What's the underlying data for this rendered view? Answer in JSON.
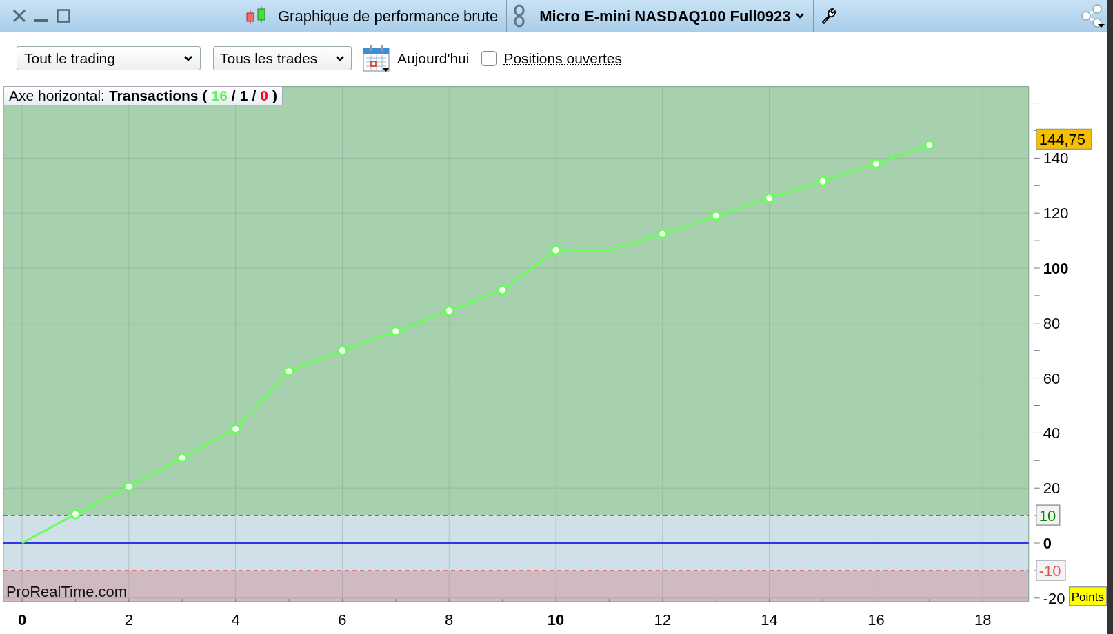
{
  "window": {
    "title": "Graphique de performance brute",
    "instrument": "Micro E-mini NASDAQ100 Full0923"
  },
  "toolbar": {
    "scope_select": "Tout le trading",
    "trades_select": "Tous les trades",
    "date_label": "Aujourd'hui",
    "open_positions": {
      "label": "Positions ouvertes",
      "checked": false
    }
  },
  "chart": {
    "legend": {
      "label": "Axe horizontal:",
      "axis_name": "Transactions",
      "tokens": [
        {
          "text": "(",
          "color": "#000000"
        },
        {
          "text": "16",
          "color": "#66ee66"
        },
        {
          "text": "/",
          "color": "#000000"
        },
        {
          "text": "1",
          "color": "#000000"
        },
        {
          "text": "/",
          "color": "#000000"
        },
        {
          "text": "0",
          "color": "#ff0022"
        },
        {
          "text": ")",
          "color": "#000000"
        }
      ]
    },
    "brand_label": "ProRealTime.com",
    "last_value": "144,75",
    "unit_label": "Points",
    "chart_data": {
      "type": "line",
      "x": [
        0,
        1,
        2,
        3,
        4,
        5,
        6,
        7,
        8,
        9,
        10,
        11,
        12,
        13,
        14,
        15,
        16,
        17
      ],
      "series": [
        {
          "color": "#66ff55",
          "marker": "o",
          "values": [
            0,
            10.5,
            20.5,
            31,
            41.5,
            62.5,
            70,
            77,
            84.5,
            92,
            106.5,
            106.5,
            112.5,
            119,
            125.5,
            131.5,
            138,
            144.75
          ]
        }
      ],
      "xlim": [
        -0.35,
        18.86
      ],
      "ylim": [
        -21.3,
        166
      ],
      "xticks": [
        0,
        2,
        4,
        6,
        8,
        10,
        12,
        14,
        16,
        18
      ],
      "yticks": [
        -20,
        0,
        20,
        40,
        60,
        80,
        100,
        120,
        140
      ],
      "grid": true,
      "bands": [
        {
          "axis": "y",
          "from": 10,
          "to": 166,
          "color": "#a7d1ae"
        },
        {
          "axis": "y",
          "from": -10,
          "to": 10,
          "color": "#d0e0e8"
        },
        {
          "axis": "y",
          "from": -21.3,
          "to": -10,
          "color": "#d0bac2"
        }
      ],
      "ref_lines": [
        {
          "axis": "y",
          "value": 10,
          "label": "10",
          "color": "#008800"
        },
        {
          "axis": "y",
          "value": 0,
          "color": "#0000ee"
        },
        {
          "axis": "y",
          "value": -10,
          "label": "-10",
          "color": "#e05555"
        }
      ]
    }
  }
}
